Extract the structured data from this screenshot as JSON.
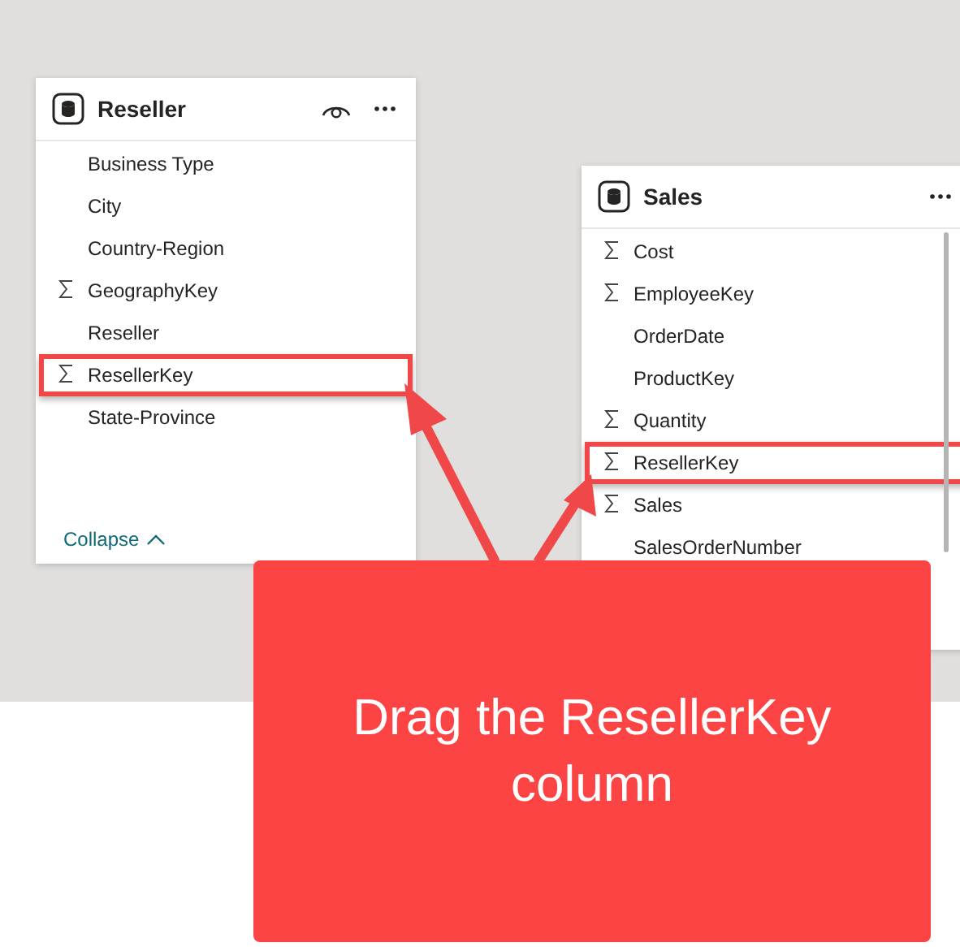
{
  "tables": [
    {
      "title": "Reseller",
      "show_eye": true,
      "fields": [
        {
          "name": "Business Type",
          "sigma": false,
          "highlighted": false
        },
        {
          "name": "City",
          "sigma": false,
          "highlighted": false
        },
        {
          "name": "Country-Region",
          "sigma": false,
          "highlighted": false
        },
        {
          "name": "GeographyKey",
          "sigma": true,
          "highlighted": false
        },
        {
          "name": "Reseller",
          "sigma": false,
          "highlighted": false
        },
        {
          "name": "ResellerKey",
          "sigma": true,
          "highlighted": true
        },
        {
          "name": "State-Province",
          "sigma": false,
          "highlighted": false
        }
      ],
      "collapse": "Collapse"
    },
    {
      "title": "Sales",
      "fields": [
        {
          "name": "Cost",
          "sigma": true,
          "highlighted": false
        },
        {
          "name": "EmployeeKey",
          "sigma": true,
          "highlighted": false
        },
        {
          "name": "OrderDate",
          "sigma": false,
          "highlighted": false
        },
        {
          "name": "ProductKey",
          "sigma": false,
          "highlighted": false
        },
        {
          "name": "Quantity",
          "sigma": true,
          "highlighted": false
        },
        {
          "name": "ResellerKey",
          "sigma": true,
          "highlighted": true
        },
        {
          "name": "Sales",
          "sigma": true,
          "highlighted": false
        },
        {
          "name": "SalesOrderNumber",
          "sigma": false,
          "highlighted": false
        }
      ],
      "scrollbar": true
    }
  ],
  "callout": {
    "text": "Drag the ResellerKey column"
  }
}
